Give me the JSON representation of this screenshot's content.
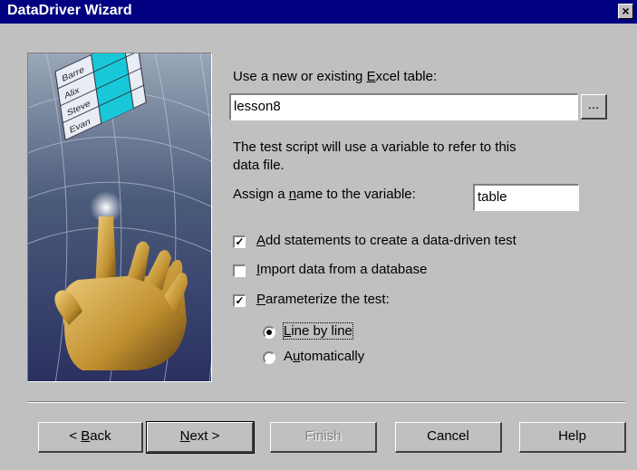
{
  "window": {
    "title": "DataDriver Wizard",
    "close_glyph": "×"
  },
  "excel": {
    "label_pre": "Use a new or existing ",
    "label_mnemonic": "E",
    "label_post": "xcel table:",
    "value": "lesson8",
    "browse_label": "..."
  },
  "description": "The test script will use a variable to refer to this data file.",
  "variable": {
    "label_pre": "Assign a ",
    "label_mnemonic": "n",
    "label_post": "ame to the variable:",
    "value": "table"
  },
  "options": {
    "add_statements": {
      "mnemonic": "A",
      "rest": "dd statements to create a data-driven test",
      "checked": true
    },
    "import_data": {
      "mnemonic": "I",
      "rest": "mport data from a database",
      "checked": false
    },
    "parameterize": {
      "mnemonic": "P",
      "rest": "arameterize the test:",
      "checked": true
    },
    "line_by_line": {
      "mnemonic": "L",
      "rest": "ine by line",
      "selected": true
    },
    "automatically": {
      "pre": "A",
      "mnemonic": "u",
      "rest": "tomatically",
      "selected": false
    }
  },
  "buttons": {
    "back": {
      "pre": "< ",
      "mnemonic": "B",
      "rest": "ack"
    },
    "next": {
      "mnemonic": "N",
      "rest": "ext >"
    },
    "finish": "Finish",
    "cancel": "Cancel",
    "help": "Help"
  },
  "picture_labels": [
    "Barre",
    "Alix",
    "Steve",
    "Evan"
  ],
  "check_glyph": "✓"
}
